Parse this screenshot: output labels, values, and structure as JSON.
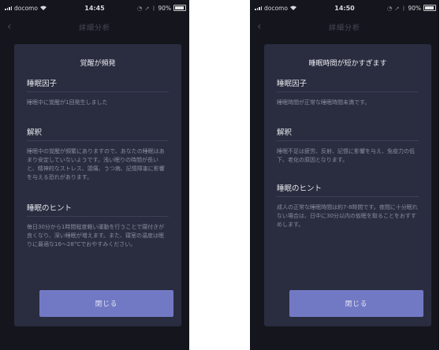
{
  "screens": [
    {
      "status": {
        "carrier": "docomo",
        "time": "14:45",
        "battery": "90%"
      },
      "nav_title": "詳細分析",
      "modal": {
        "title": "覚醒が頻発",
        "sections": [
          {
            "heading": "睡眠因子",
            "body": "睡眠中に覚醒が1回発生しました"
          },
          {
            "heading": "解釈",
            "body": "睡眠中の覚醒が頻繁にありますので、あなたの睡眠はあまり安定していないようです。浅い眠りの時間が長いと、精神的なストレス、頭痛、うつ病、記憶障害に影響を与える恐れがあります。"
          },
          {
            "heading": "睡眠のヒント",
            "body": "毎日30分から1時間程度軽い運動を行うことで寝付きが良くなり、深い睡眠が増えます。また、寝室の温度は眠りに最適な16〜28°Cでおやすみください。"
          }
        ],
        "close_label": "閉じる"
      }
    },
    {
      "status": {
        "carrier": "docomo",
        "time": "14:50",
        "battery": "90%"
      },
      "nav_title": "詳細分析",
      "modal": {
        "title": "睡眠時間が短かすぎます",
        "sections": [
          {
            "heading": "睡眠因子",
            "body": "睡眠時間が正常な睡眠時間未満です。"
          },
          {
            "heading": "解釈",
            "body": "睡眠不足は疲労、反射、記憶に影響を与え、免疫力の低下、老化の原因となります。"
          },
          {
            "heading": "睡眠のヒント",
            "body": "成人の正常な睡眠時間は約7-8時間です。夜間に十分眠れない場合は、日中に30分以内の仮眠を取ることをおすすめします。"
          }
        ],
        "close_label": "閉じる"
      }
    }
  ]
}
